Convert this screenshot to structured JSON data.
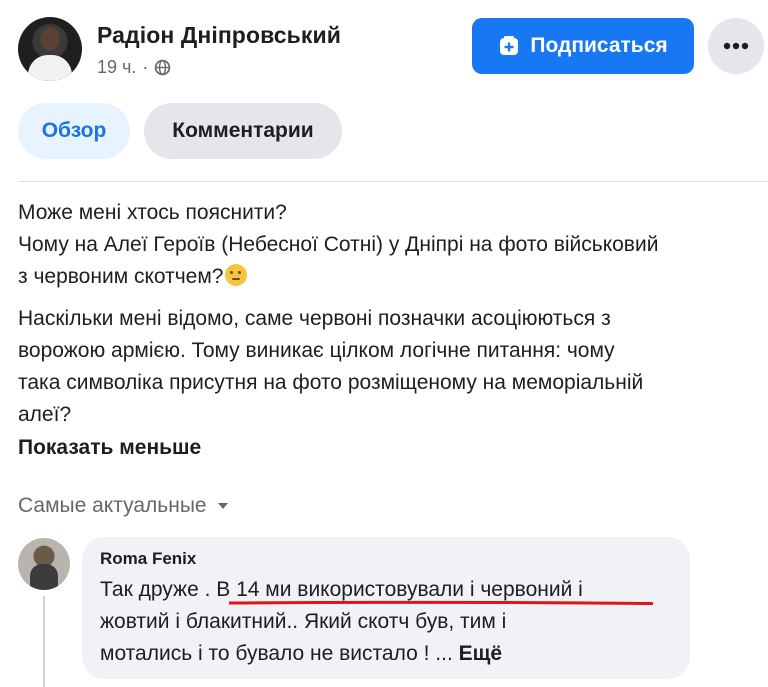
{
  "post": {
    "author": "Радіон Дніпровський",
    "time": "19 ч.",
    "separator": "·",
    "follow_label": "Подписаться",
    "tabs": [
      {
        "label": "Обзор"
      },
      {
        "label": "Комментарии"
      }
    ],
    "paragraphs": [
      {
        "lines": [
          "Може мені хтось пояснити?",
          "Чому на Алеї Героїв (Небесної Сотні) у Дніпрі на фото військовий",
          "з червоним скотчем?"
        ]
      },
      {
        "lines": [
          "Наскільки мені відомо, саме червоні позначки асоціюються з",
          "ворожою армією. Тому виникає цілком логічне питання: чому",
          "така символіка присутня на фото розміщеному на меморіальній",
          "алеї?"
        ]
      }
    ],
    "show_less_label": "Показать меньше"
  },
  "comments_section": {
    "sort_label": "Самые актуальные"
  },
  "comment": {
    "author": "Roma Fenix",
    "text_before": "Так друже . ",
    "text_highlighted": "В 14 ми використовували і червоний",
    "text_after_line1": " і",
    "line2": "жовтий і блакитний.. Який скотч був, тим і",
    "line3": "мотались і то бувало не вистало ! ... ",
    "more_label": "Ещё"
  },
  "colors": {
    "accent": "#1877f2",
    "underline": "#e0141b"
  },
  "icons": {
    "globe": "globe-icon",
    "follow": "follow-icon",
    "more": "more-horizontal-icon",
    "sort": "caret-down-icon",
    "emoji": "thinking-face-emoji"
  }
}
